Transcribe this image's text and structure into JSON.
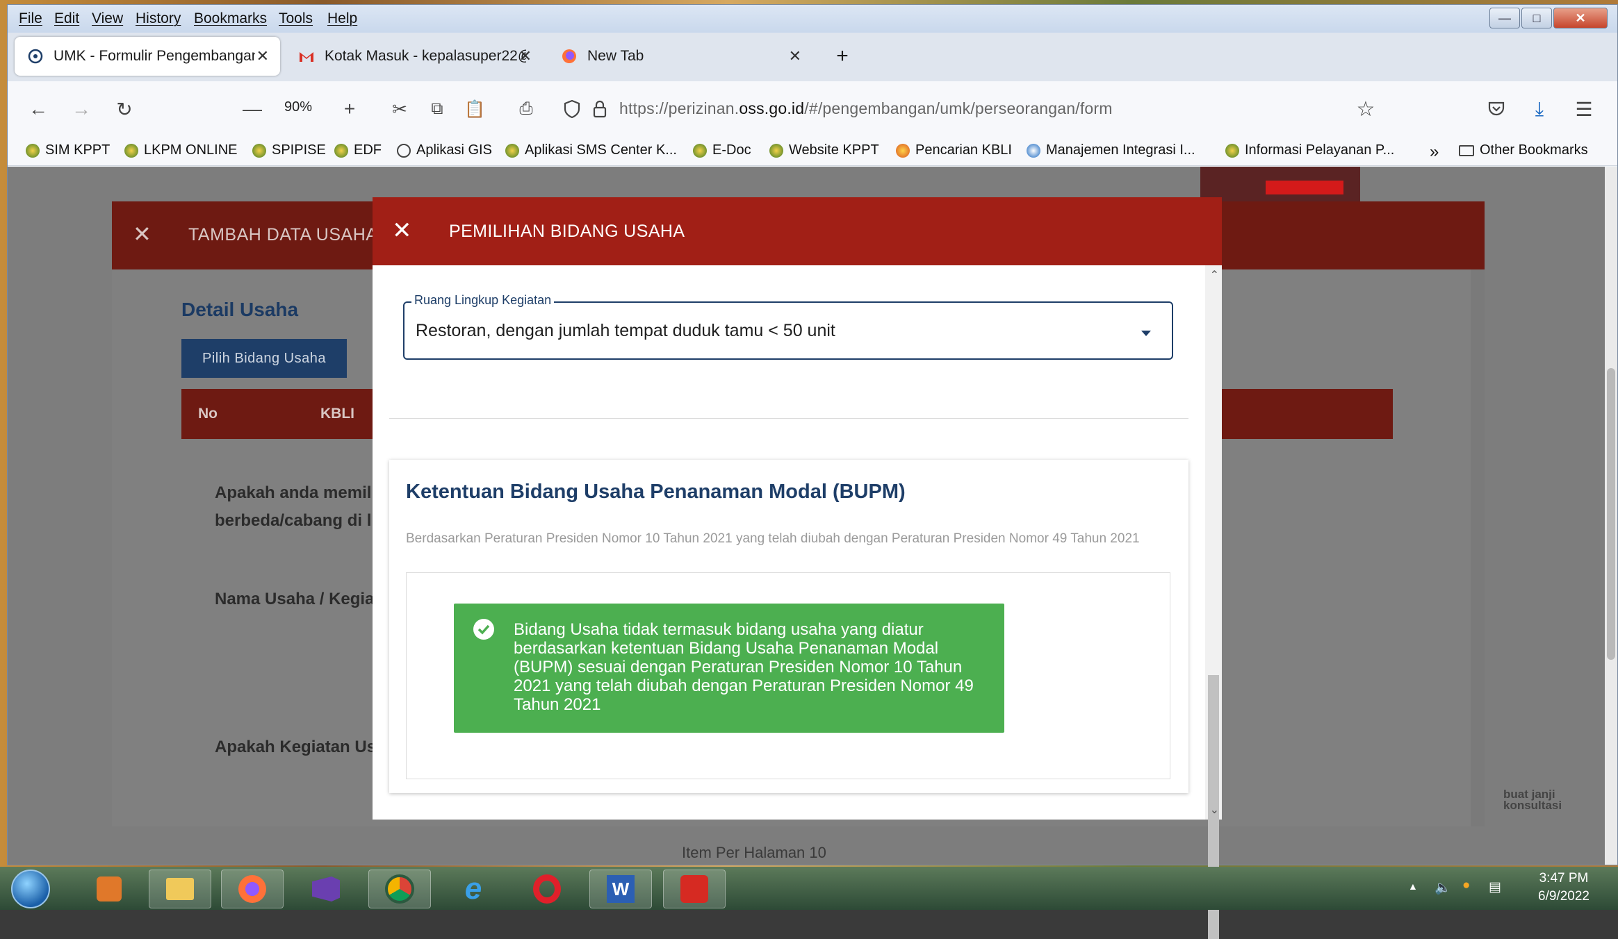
{
  "menubar": {
    "items": [
      "File",
      "Edit",
      "View",
      "History",
      "Bookmarks",
      "Tools",
      "Help"
    ]
  },
  "tabs": [
    {
      "label": "UMK - Formulir Pengembangan",
      "active": true
    },
    {
      "label": "Kotak Masuk - kepalasuper22@",
      "active": false
    },
    {
      "label": "New Tab",
      "active": false
    }
  ],
  "nav": {
    "zoom": "90%",
    "url_prefix": "https://perizinan.",
    "url_domain": "oss.go.id",
    "url_path": "/#/pengembangan/umk/perseorangan/form"
  },
  "bookmarks": [
    "SIM KPPT",
    "LKPM ONLINE",
    "SPIPISE",
    "EDF",
    "Aplikasi GIS",
    "Aplikasi SMS Center K...",
    "E-Doc",
    "Website KPPT",
    "Pencarian KBLI",
    "Manajemen Integrasi I...",
    "Informasi Pelayanan P...",
    "Other Bookmarks"
  ],
  "background_modal": {
    "title": "TAMBAH DATA USAHA",
    "section_title": "Detail Usaha",
    "pilih_button": "Pilih Bidang Usaha",
    "table_headers": [
      "No",
      "KBLI"
    ],
    "question_1_line1": "Apakah anda memil",
    "question_1_line2": "berbeda/cabang di l",
    "nama_usaha": "Nama Usaha / Kegia",
    "apakah_kegiatan": "Apakah Kegiatan Us",
    "items_per_page": "Item Per Halaman  10"
  },
  "side_widget": {
    "line1": "buat janji",
    "line2": "konsultasi"
  },
  "modal": {
    "title": "PEMILIHAN BIDANG USAHA",
    "field_label": "Ruang Lingkup Kegiatan",
    "field_value": "Restoran, dengan jumlah tempat duduk tamu < 50 unit",
    "card_title": "Ketentuan Bidang Usaha Penanaman Modal (BUPM)",
    "card_subtitle": "Berdasarkan Peraturan Presiden Nomor 10 Tahun 2021 yang telah diubah dengan Peraturan Presiden Nomor 49 Tahun 2021",
    "alert_text": "Bidang Usaha tidak termasuk bidang usaha yang diatur berdasarkan ketentuan Bidang Usaha Penanaman Modal (BUPM) sesuai dengan Peraturan Presiden Nomor 10 Tahun 2021 yang telah diubah dengan Peraturan Presiden Nomor 49 Tahun 2021"
  },
  "taskbar": {
    "time": "3:47 PM",
    "date": "6/9/2022"
  },
  "colors": {
    "modal_header": "#a11f16",
    "primary_blue": "#1e3e68",
    "alert_green": "#4caf50"
  }
}
